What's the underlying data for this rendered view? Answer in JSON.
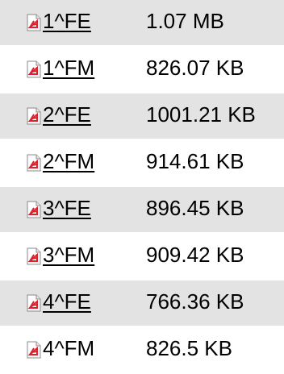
{
  "files": [
    {
      "name": "1^FE",
      "size": "1.07 MB",
      "icon": "pdf-icon"
    },
    {
      "name": "1^FM",
      "size": "826.07 KB",
      "icon": "pdf-icon"
    },
    {
      "name": "2^FE",
      "size": "1001.21 KB",
      "icon": "pdf-icon"
    },
    {
      "name": "2^FM",
      "size": "914.61 KB",
      "icon": "pdf-icon"
    },
    {
      "name": "3^FE",
      "size": "896.45 KB",
      "icon": "pdf-icon"
    },
    {
      "name": "3^FM",
      "size": "909.42 KB",
      "icon": "pdf-icon"
    },
    {
      "name": "4^FE",
      "size": "766.36 KB",
      "icon": "pdf-icon"
    },
    {
      "name": "4^FM",
      "size": "826.5 KB",
      "icon": "pdf-icon"
    }
  ],
  "colors": {
    "row_shade": "#e3e3e3",
    "icon_red": "#d9232e"
  }
}
